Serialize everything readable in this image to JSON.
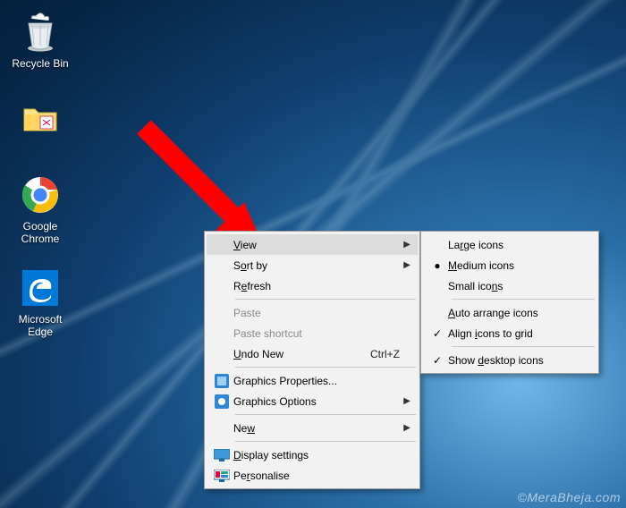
{
  "watermark": "©MeraBheja.com",
  "desktop": {
    "icons": [
      {
        "name": "recycle-bin-icon",
        "label": "Recycle Bin"
      },
      {
        "name": "folder-icon",
        "label": " "
      },
      {
        "name": "chrome-icon",
        "label": "Google Chrome"
      },
      {
        "name": "edge-icon",
        "label": "Microsoft Edge"
      }
    ]
  },
  "context_menu": {
    "items": [
      {
        "label": "View",
        "submenu": true,
        "highlight": true,
        "accel_letter": "V"
      },
      {
        "label": "Sort by",
        "submenu": true,
        "accel_letter": "o"
      },
      {
        "label": "Refresh",
        "accel_letter": "e"
      },
      {
        "sep": true
      },
      {
        "label": "Paste",
        "disabled": true,
        "accel_letter": "P"
      },
      {
        "label": "Paste shortcut",
        "disabled": true,
        "accel_letter": "s"
      },
      {
        "label": "Undo New",
        "shortcut": "Ctrl+Z",
        "accel_letter": "U"
      },
      {
        "sep": true
      },
      {
        "label": "Graphics Properties...",
        "icon": "intel-props-icon"
      },
      {
        "label": "Graphics Options",
        "icon": "intel-options-icon",
        "submenu": true
      },
      {
        "sep": true
      },
      {
        "label": "New",
        "submenu": true,
        "accel_letter": "w"
      },
      {
        "sep": true
      },
      {
        "label": "Display settings",
        "icon": "display-settings-icon",
        "accel_letter": "D"
      },
      {
        "label": "Personalise",
        "icon": "personalise-icon",
        "accel_letter": "r"
      }
    ]
  },
  "view_submenu": {
    "items": [
      {
        "label": "Large icons",
        "accel_letter": "r"
      },
      {
        "label": "Medium icons",
        "radio": true,
        "accel_letter": "M"
      },
      {
        "label": "Small icons",
        "accel_letter": "N"
      },
      {
        "sep": true
      },
      {
        "label": "Auto arrange icons",
        "accel_letter": "A"
      },
      {
        "label": "Align icons to grid",
        "check": true,
        "accel_letter": "i"
      },
      {
        "sep": true
      },
      {
        "label": "Show desktop icons",
        "check": true,
        "accel_letter": "d"
      }
    ]
  },
  "arrow_color": "#ff0000"
}
